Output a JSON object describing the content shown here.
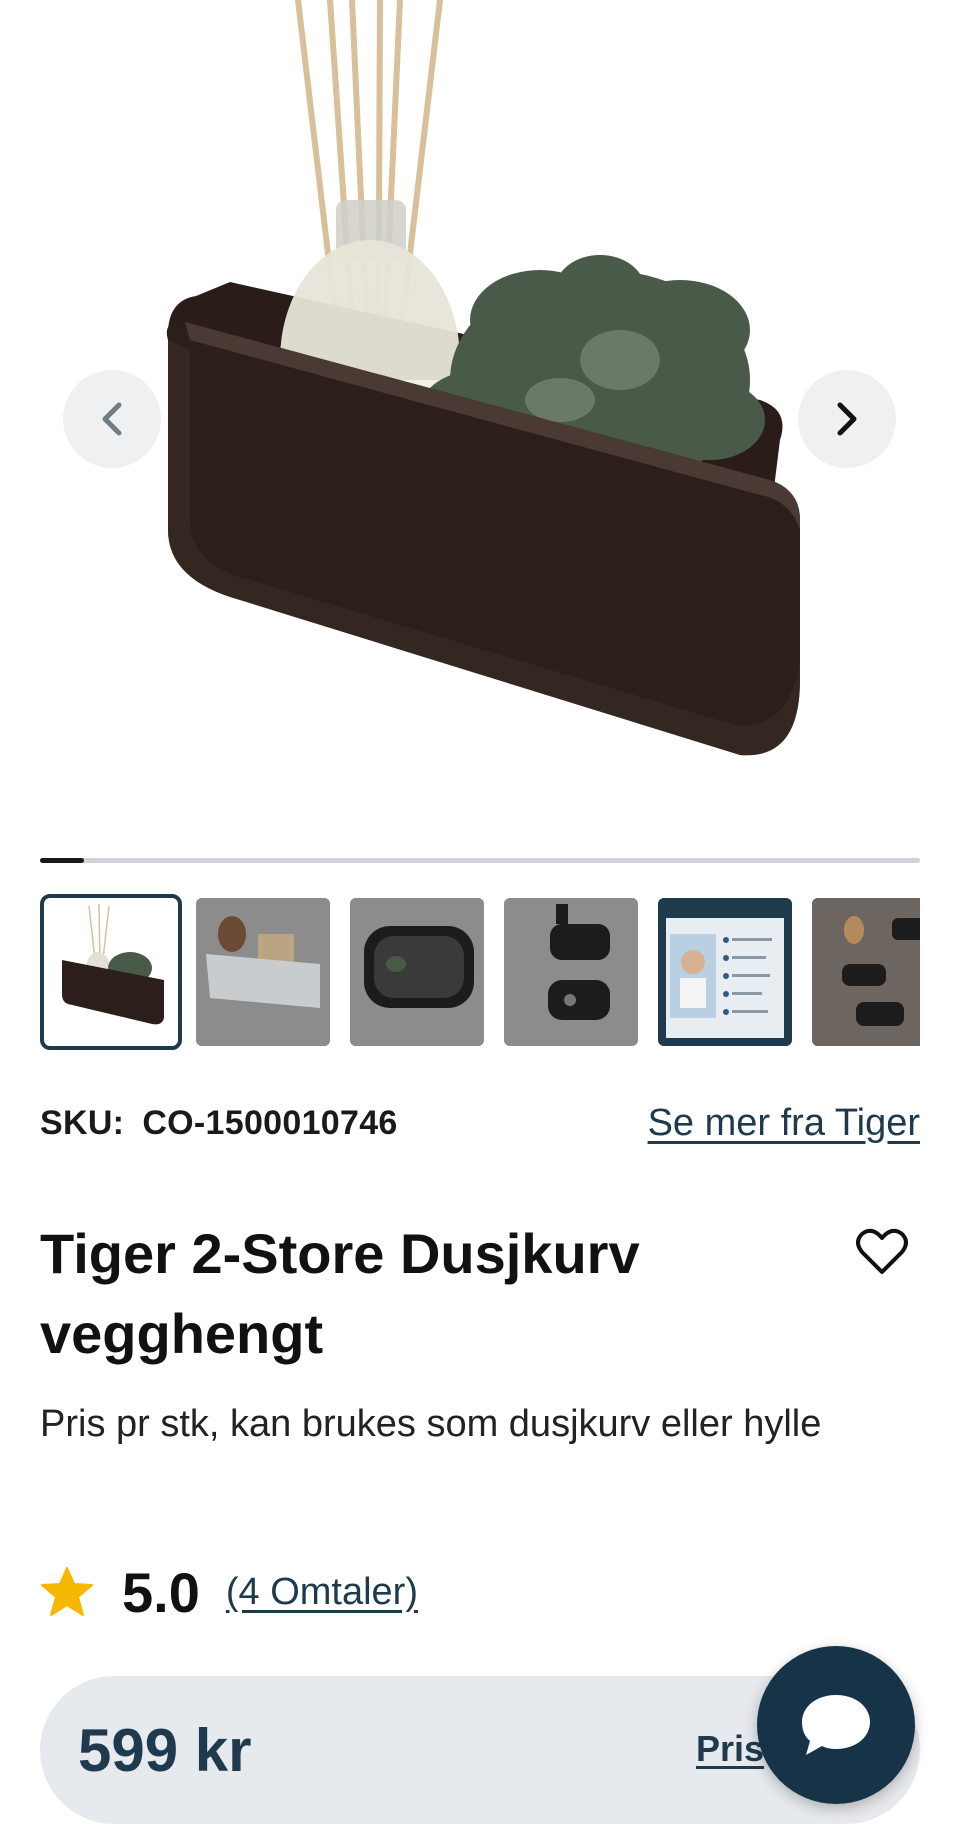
{
  "gallery": {
    "prev_icon": "chevron-left-icon",
    "next_icon": "chevron-right-icon",
    "progress_fraction": 0.05,
    "thumbnails": [
      {
        "name": "thumb-black-basket",
        "active": true
      },
      {
        "name": "thumb-white-basket",
        "active": false
      },
      {
        "name": "thumb-black-shelf",
        "active": false
      },
      {
        "name": "thumb-wall-mounted",
        "active": false
      },
      {
        "name": "thumb-promo",
        "active": false
      },
      {
        "name": "thumb-bathroom",
        "active": false
      }
    ]
  },
  "product": {
    "sku_label": "SKU:",
    "sku_value": "CO-1500010746",
    "brand_link": "Se mer fra Tiger",
    "title": "Tiger 2-Store Dusjkurv vegghengt",
    "subtitle": "Pris pr stk, kan brukes som dusjkurv eller hylle",
    "favorite_icon": "heart-outline-icon"
  },
  "rating": {
    "icon": "star-icon",
    "value": "5.0",
    "reviews_link": "(4 Omtaler)"
  },
  "price_bar": {
    "price": "599 kr",
    "pris_link": "Pris"
  },
  "chat": {
    "icon": "chat-bubble-icon"
  },
  "colors": {
    "accent": "#1e3a4c",
    "chat_bg": "#163347",
    "star": "#f5b700",
    "price_bar_bg": "#e6e9ed"
  }
}
